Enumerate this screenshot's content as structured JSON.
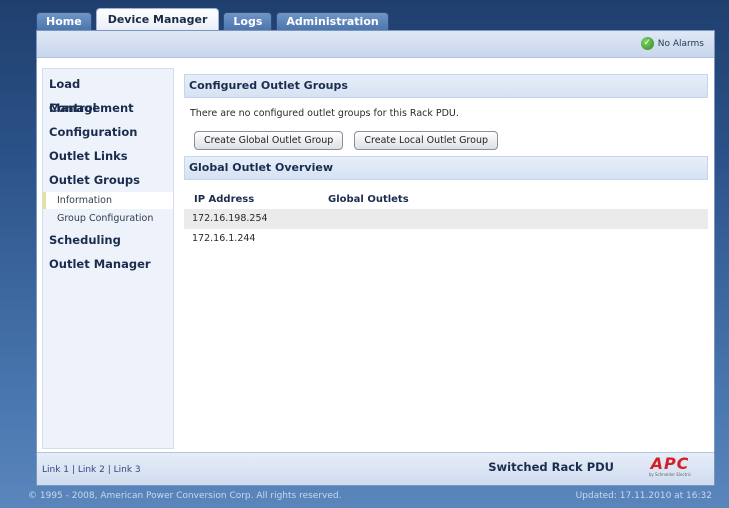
{
  "tabs": [
    "Home",
    "Device Manager",
    "Logs",
    "Administration"
  ],
  "active_tab": "Device Manager",
  "alarm": {
    "text": "No Alarms",
    "icon": "check-circle-icon",
    "color": "#2e8a1f"
  },
  "sidebar": {
    "items": [
      {
        "label": "Load Management"
      },
      {
        "label": "Control"
      },
      {
        "label": "Configuration"
      },
      {
        "label": "Outlet Links"
      },
      {
        "label": "Outlet Groups",
        "sub": [
          {
            "label": "Information",
            "selected": true
          },
          {
            "label": "Group Configuration"
          }
        ]
      },
      {
        "label": "Scheduling"
      },
      {
        "label": "Outlet Manager"
      }
    ]
  },
  "main": {
    "configured": {
      "title": "Configured Outlet Groups",
      "message": "There are no configured outlet groups for this Rack PDU.",
      "buttons": [
        "Create Global Outlet Group",
        "Create Local Outlet Group"
      ]
    },
    "overview": {
      "title": "Global Outlet Overview",
      "columns": [
        "IP Address",
        "Global Outlets"
      ],
      "rows": [
        {
          "ip": "172.16.198.254",
          "outlets": ""
        },
        {
          "ip": "172.16.1.244",
          "outlets": ""
        }
      ]
    }
  },
  "footer": {
    "links": [
      "Link 1",
      "Link 2",
      "Link 3"
    ],
    "product": "Switched Rack PDU",
    "logo_text": "APC",
    "logo_sub": "by Schneider Electric"
  },
  "copyright": "© 1995 - 2008, American Power Conversion Corp. All rights reserved.",
  "updated": "Updated: 17.11.2010 at 16:32",
  "colors": {
    "accent": "#1b2d4f",
    "brand_red": "#d41f26",
    "background": "#2b5288"
  }
}
